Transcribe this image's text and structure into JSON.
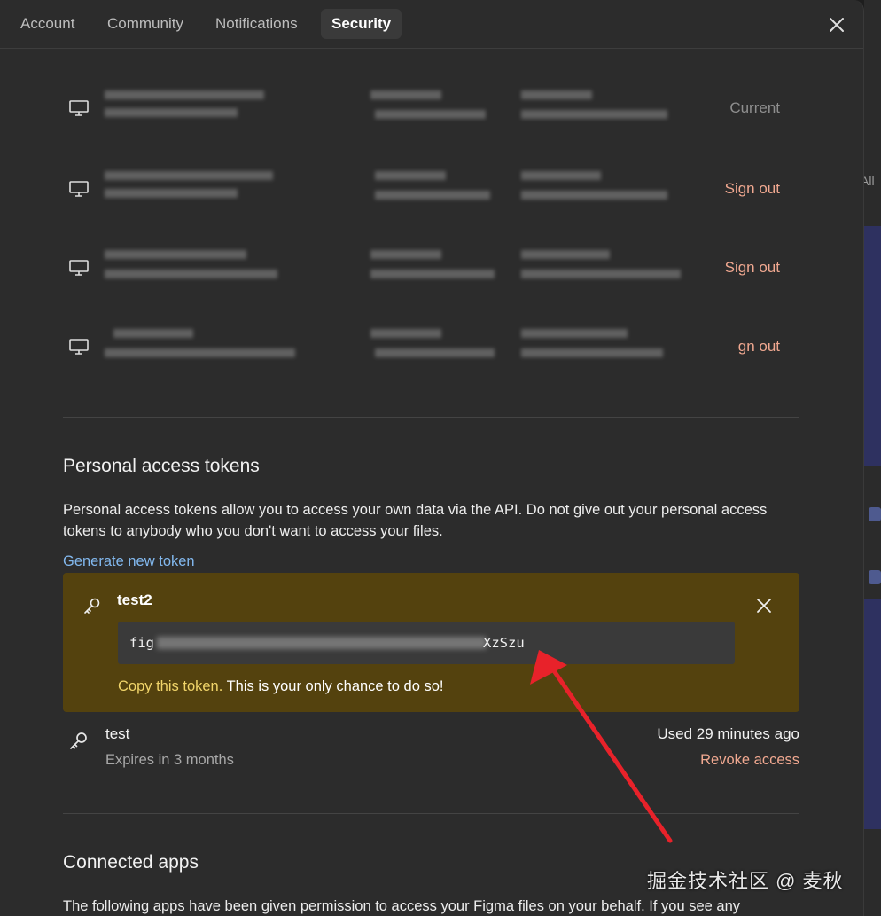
{
  "tabs": [
    {
      "label": "Account"
    },
    {
      "label": "Community"
    },
    {
      "label": "Notifications"
    },
    {
      "label": "Security",
      "active": true
    }
  ],
  "sessions": [
    {
      "action": "Current",
      "action_type": "current"
    },
    {
      "action": "Sign out",
      "action_type": "signout"
    },
    {
      "action": "Sign out",
      "action_type": "signout"
    },
    {
      "action": "gn out",
      "action_type": "signout"
    }
  ],
  "pat": {
    "title": "Personal access tokens",
    "description": "Personal access tokens allow you to access your own data via the API. Do not give out your personal access tokens to anybody who you don't want to access your files.",
    "generate_label": "Generate new token",
    "new_token": {
      "name": "test2",
      "value_prefix": "fig",
      "value_suffix": "XzSzu",
      "copy_highlight": "Copy this token.",
      "copy_rest": " This is your only chance to do so!"
    },
    "existing_token": {
      "name": "test",
      "expires": "Expires in 3 months",
      "used": "Used 29 minutes ago",
      "revoke_label": "Revoke access"
    }
  },
  "connected_apps": {
    "title": "Connected apps",
    "description": "The following apps have been given permission to access your Figma files on your behalf. If you see any"
  },
  "background": {
    "all_label": "All"
  },
  "watermark": "掘金技术社区 @ 麦秋",
  "colors": {
    "accent_link": "#82b8ee",
    "danger_link": "#f0a890",
    "token_bg": "#54420e",
    "arrow": "#e8222a"
  }
}
